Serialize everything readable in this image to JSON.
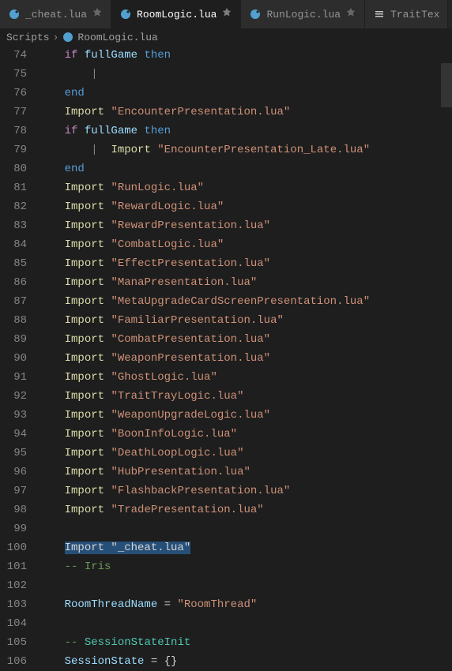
{
  "tabs": [
    {
      "label": "_cheat.lua",
      "icon": "lua",
      "pinned": true,
      "active": false
    },
    {
      "label": "RoomLogic.lua",
      "icon": "lua",
      "pinned": true,
      "active": true
    },
    {
      "label": "RunLogic.lua",
      "icon": "lua",
      "pinned": true,
      "active": false
    },
    {
      "label": "TraitTex",
      "icon": "settings",
      "pinned": false,
      "active": false
    }
  ],
  "breadcrumb": {
    "folder": "Scripts",
    "file": "RoomLogic.lua"
  },
  "lines": [
    {
      "n": 74,
      "tokens": [
        [
          "sp",
          1
        ],
        [
          "kw",
          "if"
        ],
        [
          "p",
          " "
        ],
        [
          "id",
          "fullGame"
        ],
        [
          "p",
          " "
        ],
        [
          "bl",
          "then"
        ]
      ]
    },
    {
      "n": 75,
      "tokens": [
        [
          "sp",
          2
        ],
        [
          "guide",
          ""
        ]
      ]
    },
    {
      "n": 76,
      "tokens": [
        [
          "sp",
          1
        ],
        [
          "bl",
          "end"
        ]
      ]
    },
    {
      "n": 77,
      "tokens": [
        [
          "sp",
          1
        ],
        [
          "fn",
          "Import"
        ],
        [
          "p",
          " "
        ],
        [
          "str",
          "\"EncounterPresentation.lua\""
        ]
      ]
    },
    {
      "n": 78,
      "tokens": [
        [
          "sp",
          1
        ],
        [
          "kw",
          "if"
        ],
        [
          "p",
          " "
        ],
        [
          "id",
          "fullGame"
        ],
        [
          "p",
          " "
        ],
        [
          "bl",
          "then"
        ]
      ]
    },
    {
      "n": 79,
      "tokens": [
        [
          "sp",
          2
        ],
        [
          "guide",
          ""
        ],
        [
          "p",
          "  "
        ],
        [
          "fn",
          "Import"
        ],
        [
          "p",
          " "
        ],
        [
          "str",
          "\"EncounterPresentation_Late.lua\""
        ]
      ]
    },
    {
      "n": 80,
      "tokens": [
        [
          "sp",
          1
        ],
        [
          "bl",
          "end"
        ]
      ]
    },
    {
      "n": 81,
      "tokens": [
        [
          "sp",
          1
        ],
        [
          "fn",
          "Import"
        ],
        [
          "p",
          " "
        ],
        [
          "str",
          "\"RunLogic.lua\""
        ]
      ]
    },
    {
      "n": 82,
      "tokens": [
        [
          "sp",
          1
        ],
        [
          "fn",
          "Import"
        ],
        [
          "p",
          " "
        ],
        [
          "str",
          "\"RewardLogic.lua\""
        ]
      ]
    },
    {
      "n": 83,
      "tokens": [
        [
          "sp",
          1
        ],
        [
          "fn",
          "Import"
        ],
        [
          "p",
          " "
        ],
        [
          "str",
          "\"RewardPresentation.lua\""
        ]
      ]
    },
    {
      "n": 84,
      "tokens": [
        [
          "sp",
          1
        ],
        [
          "fn",
          "Import"
        ],
        [
          "p",
          " "
        ],
        [
          "str",
          "\"CombatLogic.lua\""
        ]
      ]
    },
    {
      "n": 85,
      "tokens": [
        [
          "sp",
          1
        ],
        [
          "fn",
          "Import"
        ],
        [
          "p",
          " "
        ],
        [
          "str",
          "\"EffectPresentation.lua\""
        ]
      ]
    },
    {
      "n": 86,
      "tokens": [
        [
          "sp",
          1
        ],
        [
          "fn",
          "Import"
        ],
        [
          "p",
          " "
        ],
        [
          "str",
          "\"ManaPresentation.lua\""
        ]
      ]
    },
    {
      "n": 87,
      "tokens": [
        [
          "sp",
          1
        ],
        [
          "fn",
          "Import"
        ],
        [
          "p",
          " "
        ],
        [
          "str",
          "\"MetaUpgradeCardScreenPresentation.lua\""
        ]
      ]
    },
    {
      "n": 88,
      "tokens": [
        [
          "sp",
          1
        ],
        [
          "fn",
          "Import"
        ],
        [
          "p",
          " "
        ],
        [
          "str",
          "\"FamiliarPresentation.lua\""
        ]
      ]
    },
    {
      "n": 89,
      "tokens": [
        [
          "sp",
          1
        ],
        [
          "fn",
          "Import"
        ],
        [
          "p",
          " "
        ],
        [
          "str",
          "\"CombatPresentation.lua\""
        ]
      ]
    },
    {
      "n": 90,
      "tokens": [
        [
          "sp",
          1
        ],
        [
          "fn",
          "Import"
        ],
        [
          "p",
          " "
        ],
        [
          "str",
          "\"WeaponPresentation.lua\""
        ]
      ]
    },
    {
      "n": 91,
      "tokens": [
        [
          "sp",
          1
        ],
        [
          "fn",
          "Import"
        ],
        [
          "p",
          " "
        ],
        [
          "str",
          "\"GhostLogic.lua\""
        ]
      ]
    },
    {
      "n": 92,
      "tokens": [
        [
          "sp",
          1
        ],
        [
          "fn",
          "Import"
        ],
        [
          "p",
          " "
        ],
        [
          "str",
          "\"TraitTrayLogic.lua\""
        ]
      ]
    },
    {
      "n": 93,
      "tokens": [
        [
          "sp",
          1
        ],
        [
          "fn",
          "Import"
        ],
        [
          "p",
          " "
        ],
        [
          "str",
          "\"WeaponUpgradeLogic.lua\""
        ]
      ]
    },
    {
      "n": 94,
      "tokens": [
        [
          "sp",
          1
        ],
        [
          "fn",
          "Import"
        ],
        [
          "p",
          " "
        ],
        [
          "str",
          "\"BoonInfoLogic.lua\""
        ]
      ]
    },
    {
      "n": 95,
      "tokens": [
        [
          "sp",
          1
        ],
        [
          "fn",
          "Import"
        ],
        [
          "p",
          " "
        ],
        [
          "str",
          "\"DeathLoopLogic.lua\""
        ]
      ]
    },
    {
      "n": 96,
      "tokens": [
        [
          "sp",
          1
        ],
        [
          "fn",
          "Import"
        ],
        [
          "p",
          " "
        ],
        [
          "str",
          "\"HubPresentation.lua\""
        ]
      ]
    },
    {
      "n": 97,
      "tokens": [
        [
          "sp",
          1
        ],
        [
          "fn",
          "Import"
        ],
        [
          "p",
          " "
        ],
        [
          "str",
          "\"FlashbackPresentation.lua\""
        ]
      ]
    },
    {
      "n": 98,
      "tokens": [
        [
          "sp",
          1
        ],
        [
          "fn",
          "Import"
        ],
        [
          "p",
          " "
        ],
        [
          "str",
          "\"TradePresentation.lua\""
        ]
      ]
    },
    {
      "n": 99,
      "tokens": []
    },
    {
      "n": 100,
      "tokens": [
        [
          "sp",
          1
        ],
        [
          "sel",
          "Import \"_cheat.lua\""
        ]
      ]
    },
    {
      "n": 101,
      "tokens": [
        [
          "sp",
          1
        ],
        [
          "cm",
          "-- Iris"
        ]
      ]
    },
    {
      "n": 102,
      "tokens": []
    },
    {
      "n": 103,
      "tokens": [
        [
          "sp",
          1
        ],
        [
          "id",
          "RoomThreadName"
        ],
        [
          "p",
          " "
        ],
        [
          "op",
          "="
        ],
        [
          "p",
          " "
        ],
        [
          "str",
          "\"RoomThread\""
        ]
      ]
    },
    {
      "n": 104,
      "tokens": []
    },
    {
      "n": 105,
      "tokens": [
        [
          "sp",
          1
        ],
        [
          "cm",
          "-- "
        ],
        [
          "grn",
          "SessionStateInit"
        ]
      ]
    },
    {
      "n": 106,
      "tokens": [
        [
          "sp",
          1
        ],
        [
          "id",
          "SessionState"
        ],
        [
          "p",
          " "
        ],
        [
          "op",
          "="
        ],
        [
          "p",
          " {}"
        ]
      ]
    }
  ]
}
